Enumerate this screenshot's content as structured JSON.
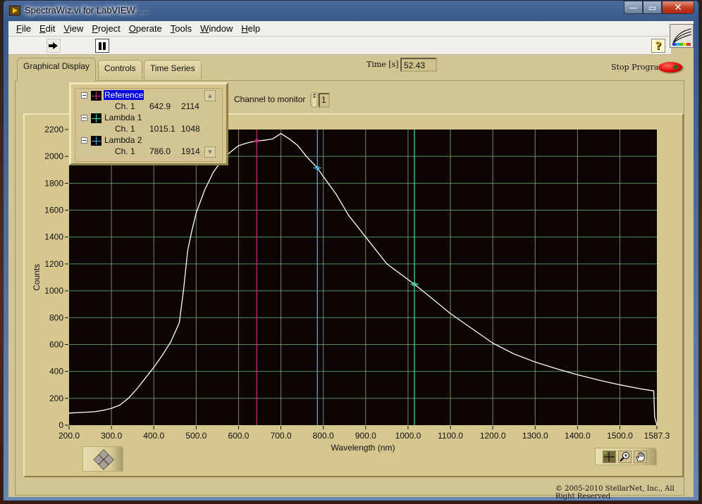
{
  "window": {
    "title": "SpectraWiz.vi for LabVIEW ....",
    "buttons": {
      "minimize": "—",
      "maximize": "▭",
      "close": "✕"
    }
  },
  "menu": [
    {
      "label": "File",
      "mnemonic": "F"
    },
    {
      "label": "Edit",
      "mnemonic": "E"
    },
    {
      "label": "View",
      "mnemonic": "V"
    },
    {
      "label": "Project",
      "mnemonic": "P"
    },
    {
      "label": "Operate",
      "mnemonic": "O"
    },
    {
      "label": "Tools",
      "mnemonic": "T"
    },
    {
      "label": "Window",
      "mnemonic": "W"
    },
    {
      "label": "Help",
      "mnemonic": "H"
    }
  ],
  "toolbar": {
    "run_icon": "run-arrow-icon",
    "pause_icon": "pause-icon",
    "help_label": "?"
  },
  "tabs": [
    {
      "label": "Graphical Display",
      "active": true
    },
    {
      "label": "Controls",
      "active": false
    },
    {
      "label": "Time Series",
      "active": false
    }
  ],
  "time": {
    "label": "Time [s]",
    "value": "52.43"
  },
  "stop": {
    "label": "Stop Program"
  },
  "channel": {
    "label": "Channel to monitor",
    "value": "1",
    "spin_glyph": "↕"
  },
  "cursor_legend": {
    "cursors": [
      {
        "name": "Reference",
        "channel": "Ch. 1",
        "x": "642.9",
        "y": "2114",
        "color": "#d02a7a",
        "selected": true
      },
      {
        "name": "Lambda 1",
        "channel": "Ch. 1",
        "x": "1015.1",
        "y": "1048",
        "color": "#3ee0b0",
        "selected": false
      },
      {
        "name": "Lambda 2",
        "channel": "Ch. 1",
        "x": "786.0",
        "y": "1914",
        "color": "#40b8ec",
        "selected": false
      }
    ],
    "scroll_up": "▲",
    "scroll_down": "▼"
  },
  "copyright": "© 2005-2010 StellarNet, Inc.,  All Right Reserved",
  "colors": {
    "plot_bg": "#0e0604",
    "grid": "#4f8f5f",
    "grid_v": "#8a9a78",
    "trace": "#ffffff",
    "panel": "#d3c493"
  },
  "chart_data": {
    "type": "line",
    "title": "",
    "xlabel": "Wavelength (nm)",
    "ylabel": "Counts",
    "xlim": [
      200.0,
      1587.3
    ],
    "ylim": [
      0,
      2200
    ],
    "grid": true,
    "x_ticks": [
      200.0,
      300.0,
      400.0,
      500.0,
      600.0,
      700.0,
      800.0,
      900.0,
      1000.0,
      1100.0,
      1200.0,
      1300.0,
      1400.0,
      1500.0,
      1587.3
    ],
    "x_tick_labels": [
      "200.0",
      "300.0",
      "400.0",
      "500.0",
      "600.0",
      "700.0",
      "800.0",
      "900.0",
      "1000.0",
      "1100.0",
      "1200.0",
      "1300.0",
      "1400.0",
      "1500.0",
      "1587.3"
    ],
    "y_ticks": [
      0,
      200,
      400,
      600,
      800,
      1000,
      1200,
      1400,
      1600,
      1800,
      2000,
      2200
    ],
    "y_tick_labels": [
      "0",
      "200",
      "400",
      "600",
      "800",
      "1000",
      "1200",
      "1400",
      "1600",
      "1800",
      "2000",
      "2200"
    ],
    "series": [
      {
        "name": "Ch. 1",
        "color": "#ffffff",
        "x": [
          200,
          230,
          260,
          280,
          300,
          320,
          340,
          360,
          380,
          400,
          420,
          440,
          460,
          470,
          480,
          490,
          500,
          520,
          540,
          560,
          580,
          600,
          620,
          640,
          660,
          680,
          700,
          720,
          740,
          760,
          786,
          800,
          830,
          860,
          900,
          950,
          1015,
          1050,
          1100,
          1150,
          1200,
          1250,
          1300,
          1350,
          1400,
          1450,
          1500,
          1550,
          1580,
          1582,
          1587.3
        ],
        "y": [
          90,
          95,
          100,
          110,
          125,
          150,
          200,
          270,
          350,
          430,
          520,
          620,
          760,
          1000,
          1300,
          1450,
          1580,
          1750,
          1880,
          1970,
          2030,
          2080,
          2100,
          2114,
          2120,
          2130,
          2170,
          2130,
          2080,
          2000,
          1914,
          1850,
          1720,
          1560,
          1400,
          1200,
          1048,
          960,
          830,
          720,
          610,
          530,
          470,
          420,
          375,
          335,
          300,
          270,
          255,
          60,
          0
        ]
      }
    ],
    "cursors": [
      {
        "name": "Reference",
        "x": 642.9,
        "y": 2114,
        "color": "#d02a7a"
      },
      {
        "name": "Lambda 1",
        "x": 1015.1,
        "y": 1048,
        "color": "#3ee0b0"
      },
      {
        "name": "Lambda 2",
        "x": 786.0,
        "y": 1914,
        "color": "#40b8ec"
      }
    ],
    "legend": "top-left"
  }
}
